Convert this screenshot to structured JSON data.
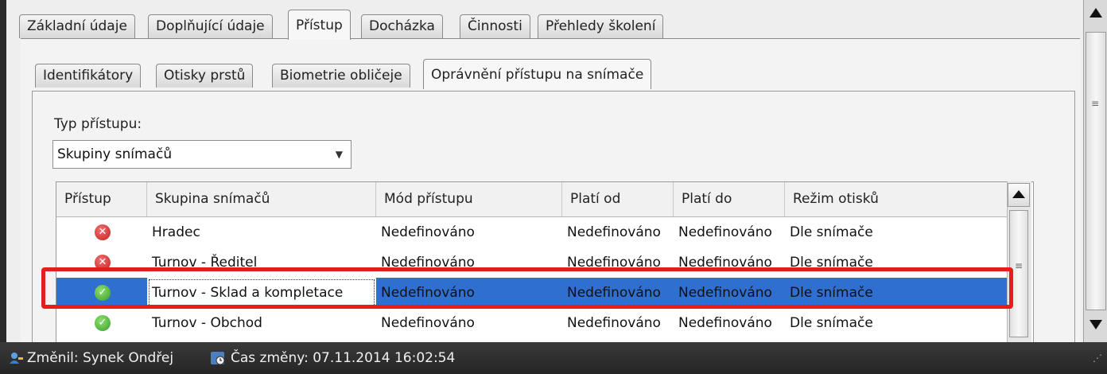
{
  "outer_tabs": [
    "Základní údaje",
    "Doplňující údaje",
    "Přístup",
    "Docházka",
    "Činnosti",
    "Přehledy školení"
  ],
  "outer_active": "Přístup",
  "inner_tabs": [
    "Identifikátory",
    "Otisky prstů",
    "Biometrie obličeje",
    "Oprávnění přístupu na snímače"
  ],
  "inner_active": "Oprávnění přístupu na snímače",
  "access_type": {
    "label": "Typ přístupu:",
    "value": "Skupiny snímačů"
  },
  "table": {
    "columns": [
      "Přístup",
      "Skupina snímačů",
      "Mód přístupu",
      "Platí od",
      "Platí do",
      "Režim otisků"
    ],
    "rows": [
      {
        "access": "deny-icon",
        "group": "Hradec",
        "mode": "Nedefinováno",
        "from": "Nedefinováno",
        "to": "Nedefinováno",
        "print_mode": "Dle snímače"
      },
      {
        "access": "deny-icon",
        "group": "Turnov - Ředitel",
        "mode": "Nedefinováno",
        "from": "Nedefinováno",
        "to": "Nedefinováno",
        "print_mode": "Dle snímače"
      },
      {
        "access": "allow-icon",
        "group": "Turnov - Sklad a kompletace",
        "mode": "Nedefinováno",
        "from": "Nedefinováno",
        "to": "Nedefinováno",
        "print_mode": "Dle snímače",
        "selected": true
      },
      {
        "access": "allow-icon",
        "group": "Turnov - Obchod",
        "mode": "Nedefinováno",
        "from": "Nedefinováno",
        "to": "Nedefinováno",
        "print_mode": "Dle snímače"
      }
    ]
  },
  "status": {
    "changed_by": "Změnil: Synek Ondřej",
    "changed_time": "Čas změny: 07.11.2014 16:02:54"
  },
  "colors": {
    "selection": "#2f6fd0",
    "highlight_border": "#e41d1d",
    "deny": "#c42020",
    "allow": "#3a9d2a"
  }
}
